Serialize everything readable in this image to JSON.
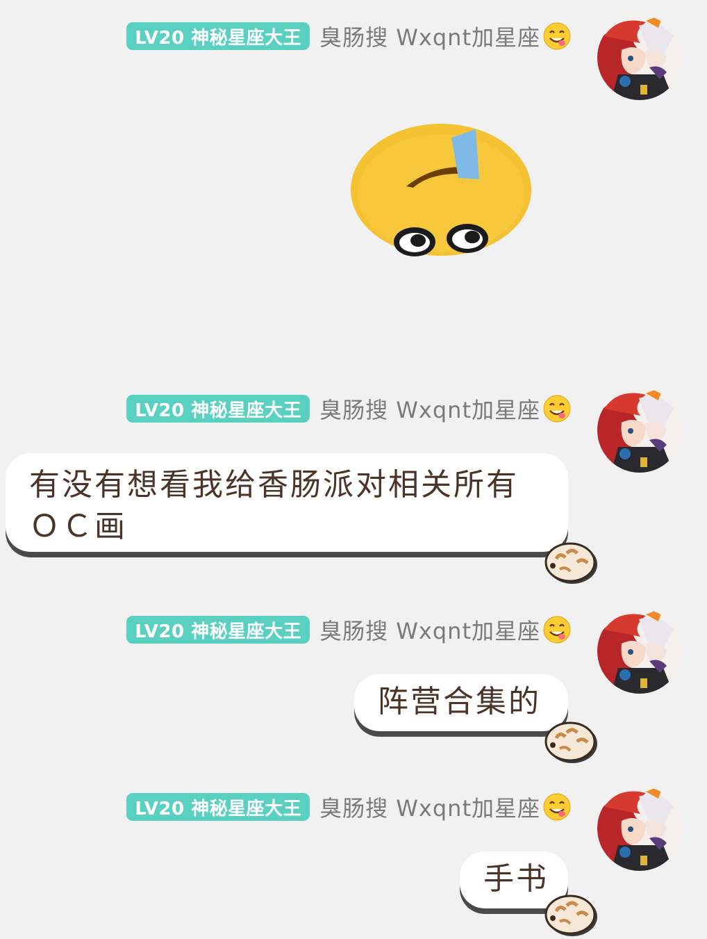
{
  "sender": {
    "level_badge": "LV20 神秘星座大王",
    "name": "臭肠搜 Wxqnt加星座",
    "name_emoji": "smiling-face-emoji",
    "avatar": "anime-avatar"
  },
  "messages": [
    {
      "type": "sticker",
      "sticker": "upside-down-peeking-face-sticker"
    },
    {
      "type": "text",
      "text_line1": "有没有想看我给香肠派对相关所有",
      "text_line2": "ＯＣ画"
    },
    {
      "type": "text",
      "text": "阵营合集的"
    },
    {
      "type": "text",
      "text": "手书"
    }
  ],
  "colors": {
    "background": "#f1f1f1",
    "badge": "#5ad0c1",
    "bubble": "#ffffff",
    "bubble_text": "#4a3328",
    "name_text": "#7a7a7a"
  }
}
